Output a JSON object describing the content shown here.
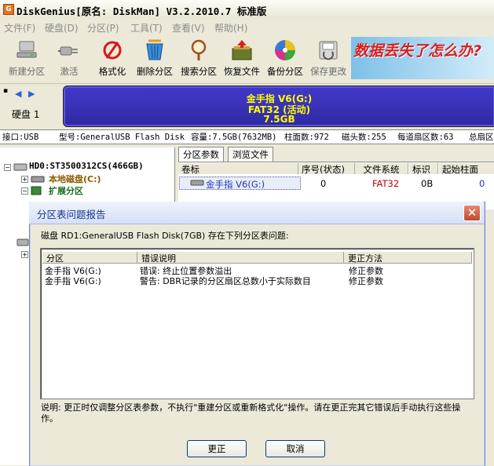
{
  "window": {
    "title": "DiskGenius[原名: DiskMan] V3.2.2010.7 标准版",
    "icon_letter": "G"
  },
  "menu": [
    "文件(F)",
    "硬盘(D)",
    "分区(P)",
    "工具(T)",
    "查看(V)",
    "帮助(H)"
  ],
  "toolbar": {
    "items": [
      {
        "label": "新建分区",
        "icon": "computer-disk-icon"
      },
      {
        "label": "激活",
        "icon": "plug-icon"
      },
      {
        "label": "格式化",
        "icon": "format-icon"
      },
      {
        "label": "删除分区",
        "icon": "trash-icon"
      },
      {
        "label": "搜索分区",
        "icon": "magnifier-icon"
      },
      {
        "label": "恢复文件",
        "icon": "recover-box-icon"
      },
      {
        "label": "备份分区",
        "icon": "pie-disc-icon"
      },
      {
        "label": "保存更改",
        "icon": "save-icon"
      }
    ],
    "ad_text": "数据丢失了怎么办?"
  },
  "disk": {
    "label": "硬盘 1",
    "bar_line1": "金手指 V6(G:)",
    "bar_line2": "FAT32 (活动)",
    "bar_line3": "7.5GB"
  },
  "info": {
    "interface": "接口:USB",
    "model": "型号:GeneralUSB Flash Disk",
    "capacity": "容量:7.5GB(7632MB)",
    "cylinders": "柱面数:972",
    "heads": "磁头数:255",
    "sectors": "每道扇区数:63",
    "total": "总扇区"
  },
  "tree": {
    "hd0": "HD0:ST3500312CS(466GB)",
    "local": "本地磁盘(C:)",
    "ext": "扩展分区"
  },
  "tabs": [
    "分区参数",
    "浏览文件"
  ],
  "grid": {
    "headers": [
      "卷标",
      "序号(状态)",
      "文件系统",
      "标识",
      "起始柱面"
    ],
    "row": {
      "label": "金手指 V6(G:)",
      "index": "0",
      "fs": "FAT32",
      "id": "0B",
      "start": "0"
    }
  },
  "dialog": {
    "title": "分区表问题报告",
    "message": "磁盘 RD1:GeneralUSB Flash Disk(7GB) 存在下列分区表问题:",
    "columns": [
      "分区",
      "错误说明",
      "更正方法"
    ],
    "rows": [
      {
        "partition": "金手指 V6(G:)",
        "error": "错误: 终止位置参数溢出",
        "fix": "修正参数"
      },
      {
        "partition": "金手指 V6(G:)",
        "error": "警告: DBR记录的分区扇区总数小于实际数目",
        "fix": "修正参数"
      }
    ],
    "note": "说明: 更正时仅调整分区表参数，不执行\"重建分区或重新格式化\"操作。请在更正完其它错误后手动执行这些操作。",
    "ok": "更正",
    "cancel": "取消"
  },
  "colors": {
    "disk_bar": "#3A32B8",
    "disk_text": "#FFFF00",
    "fs_red": "#C00000",
    "ad_red": "#D81E1E"
  }
}
